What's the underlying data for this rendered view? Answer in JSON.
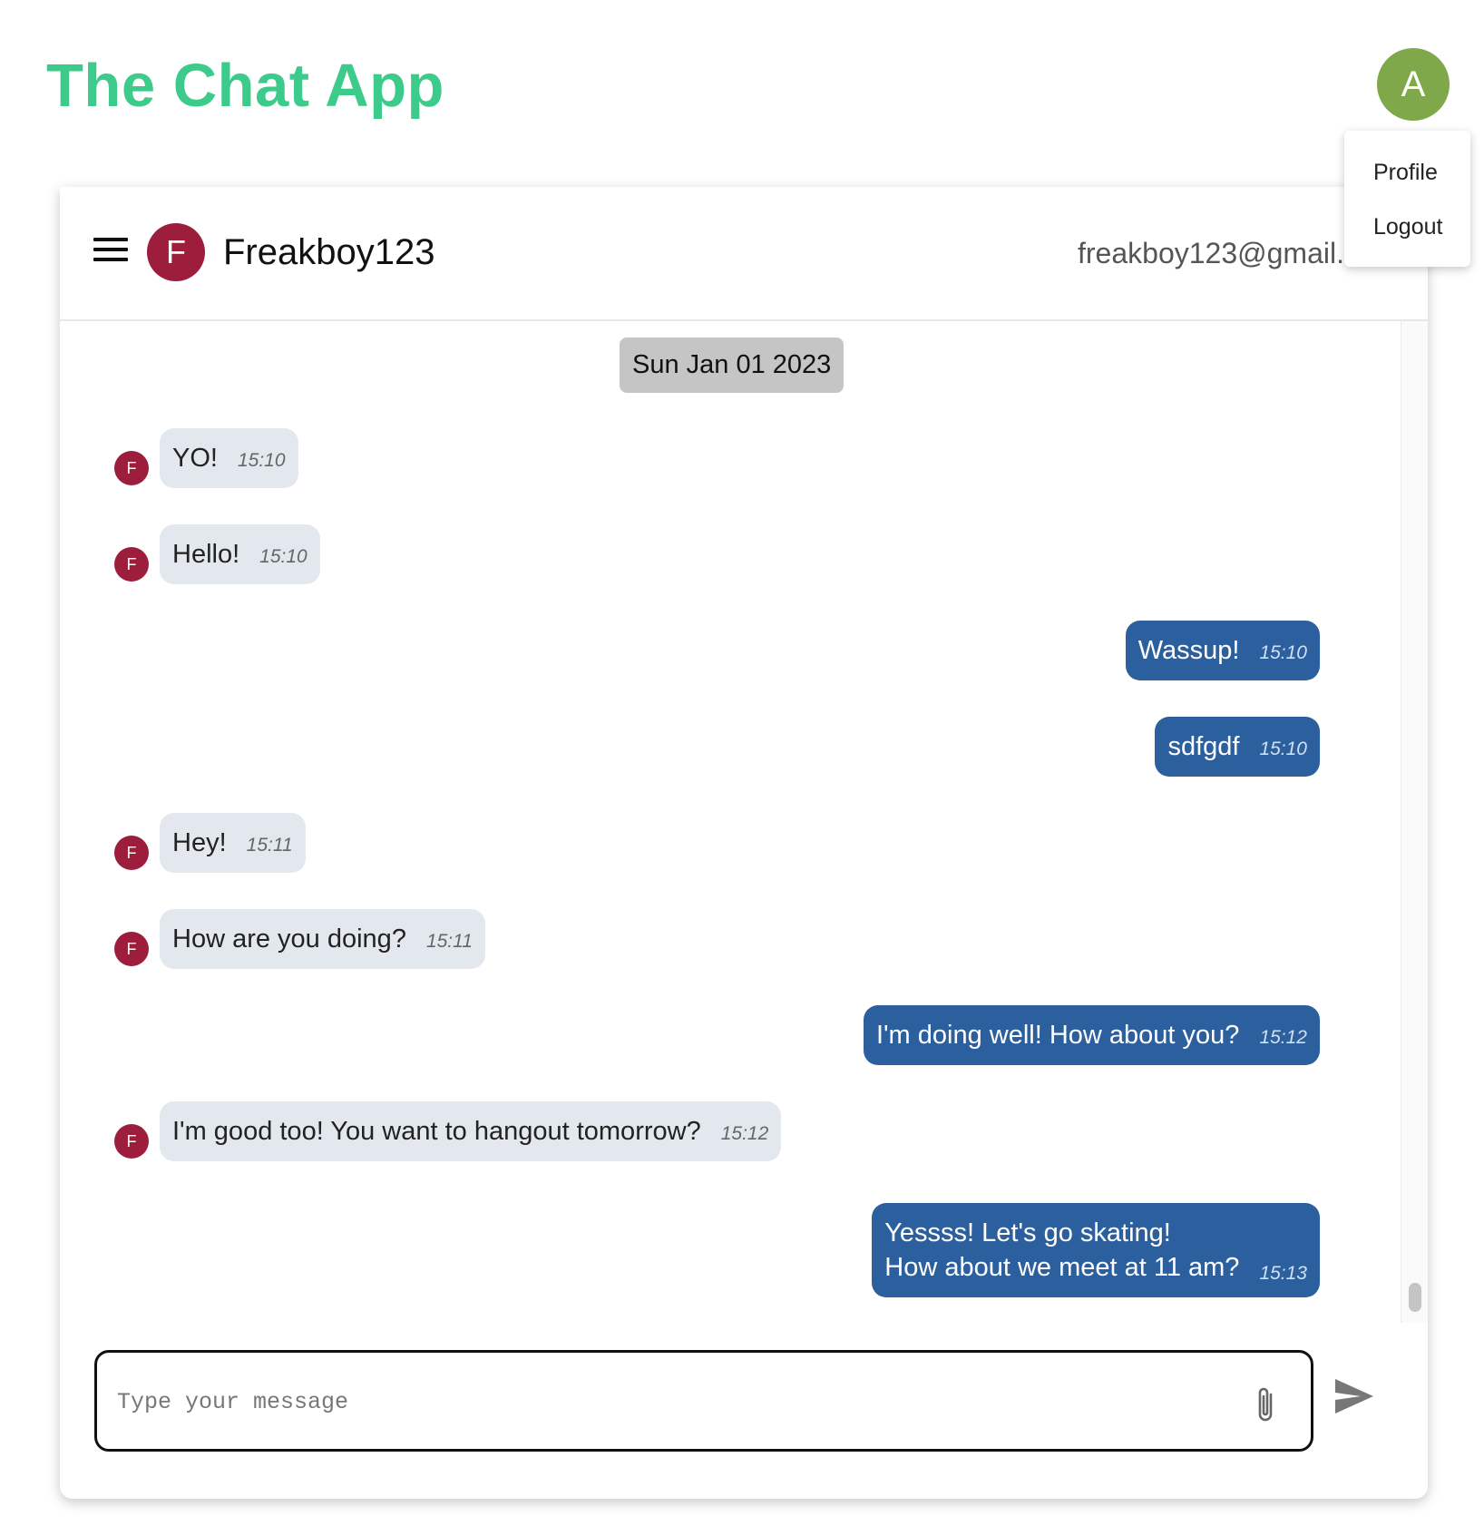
{
  "app": {
    "title": "The Chat App"
  },
  "account": {
    "avatar_initial": "A",
    "avatar_color": "#7fa84a",
    "menu": {
      "items": [
        {
          "label": "Profile"
        },
        {
          "label": "Logout"
        }
      ]
    }
  },
  "chat": {
    "contact": {
      "initial": "F",
      "name": "Freakboy123",
      "email": "freakboy123@gmail.c",
      "avatar_color": "#9c1d3c"
    },
    "date_divider": "Sun Jan 01 2023",
    "messages": [
      {
        "direction": "incoming",
        "sender_initial": "F",
        "text": "YO!",
        "time": "15:10"
      },
      {
        "direction": "incoming",
        "sender_initial": "F",
        "text": "Hello!",
        "time": "15:10"
      },
      {
        "direction": "outgoing",
        "text": "Wassup!",
        "time": "15:10"
      },
      {
        "direction": "outgoing",
        "text": "sdfgdf",
        "time": "15:10"
      },
      {
        "direction": "incoming",
        "sender_initial": "F",
        "text": "Hey!",
        "time": "15:11"
      },
      {
        "direction": "incoming",
        "sender_initial": "F",
        "text": "How are you doing?",
        "time": "15:11"
      },
      {
        "direction": "outgoing",
        "text": "I'm doing well! How about you?",
        "time": "15:12"
      },
      {
        "direction": "incoming",
        "sender_initial": "F",
        "text": "I'm good too! You want to hangout tomorrow?",
        "time": "15:12"
      },
      {
        "direction": "outgoing",
        "text_lines": [
          "Yessss! Let's go skating!",
          "How about we meet at 11 am?"
        ],
        "time": "15:13"
      }
    ],
    "composer": {
      "placeholder": "Type your message",
      "value": ""
    },
    "colors": {
      "incoming_bubble": "#e3e8ee",
      "outgoing_bubble": "#2c5f9e",
      "title": "#3dcb8b"
    }
  }
}
